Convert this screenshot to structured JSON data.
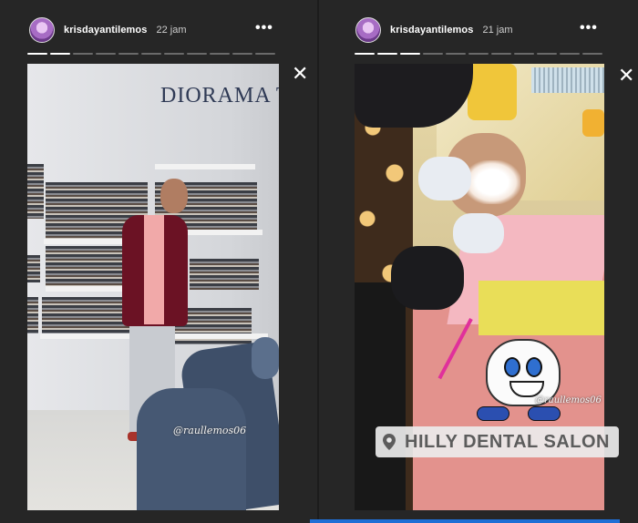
{
  "stories": [
    {
      "username": "krisdayantilemos",
      "time": "22 jam",
      "more_icon": "•••",
      "progress": {
        "segments": 11,
        "completed": 2
      },
      "photo": {
        "brand_sign": "DIORAMA T",
        "username_tag": "@raullemos06"
      }
    },
    {
      "username": "krisdayantilemos",
      "time": "21 jam",
      "more_icon": "•••",
      "progress": {
        "segments": 11,
        "completed": 3
      },
      "close_icon": "✕",
      "photo": {
        "username_tag": "@raullemos06",
        "location_sticker": "HILLY DENTAL SALON"
      }
    }
  ],
  "colors": {
    "background": "#262626",
    "progress_done": "#ffffff",
    "progress_pending": "#6a6a6a",
    "accent_line": "#1f6fd6"
  }
}
